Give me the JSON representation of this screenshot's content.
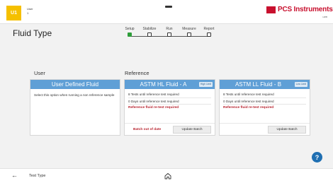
{
  "header": {
    "avatar_initials": "U1",
    "user_line1": "User",
    "user_line2": "1",
    "logo_text": "PCS Instruments",
    "logo_subtext": "HMB"
  },
  "page": {
    "title": "Fluid Type"
  },
  "stepper": {
    "steps": [
      {
        "label": "Setup",
        "active": true
      },
      {
        "label": "Stabilize",
        "active": false
      },
      {
        "label": "Run",
        "active": false
      },
      {
        "label": "Measure",
        "active": false
      },
      {
        "label": "Report",
        "active": false
      }
    ]
  },
  "user_section": {
    "label": "User",
    "card": {
      "title": "User Defined Fluid",
      "description": "Select this option when running a non reference sample"
    }
  },
  "reference_section": {
    "label": "Reference",
    "cards": [
      {
        "title": "ASTM HL Fluid - A",
        "chip": "High Limit",
        "tests_remaining": "8 Tests until reference test required",
        "days_remaining": "0 Days until reference test required",
        "retest_warning": "Reference fluid re-test required",
        "batch_status": "Batch out of date",
        "update_button": "Update Batch"
      },
      {
        "title": "ASTM LL Fluid - B",
        "chip": "Low Limit",
        "tests_remaining": "8 Tests until reference test required",
        "days_remaining": "0 Days until reference test required",
        "retest_warning": "Reference fluid re-test required",
        "update_button": "Update Batch"
      }
    ]
  },
  "help": {
    "label": "?"
  },
  "footer": {
    "back_label": "Test Type",
    "back_icon": "arrow-left-icon",
    "home_icon": "home-icon"
  },
  "colors": {
    "accent": "#5f9fd6",
    "warning": "#b8232f",
    "brand": "#c8102e",
    "avatar": "#f5c000",
    "active_step": "#2e9d3a",
    "help": "#1f6fb2"
  }
}
